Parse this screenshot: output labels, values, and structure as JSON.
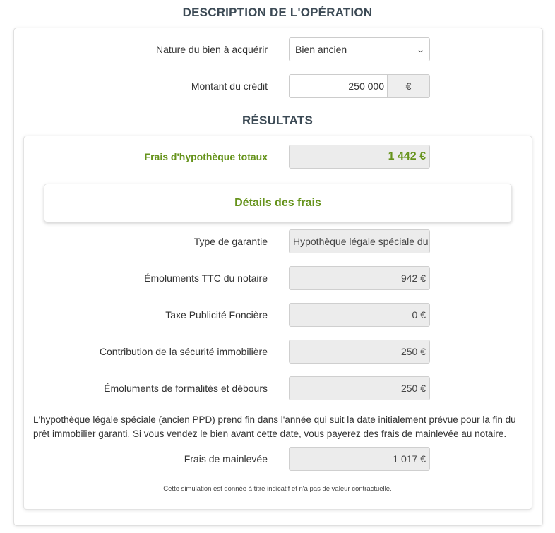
{
  "description_title": "DESCRIPTION DE L'OPÉRATION",
  "nature": {
    "label": "Nature du bien à acquérir",
    "value": "Bien ancien"
  },
  "montant": {
    "label": "Montant du crédit",
    "value": "250 000",
    "unit": "€"
  },
  "results_title": "RÉSULTATS",
  "total": {
    "label": "Frais d'hypothèque totaux",
    "value": "1 442 €"
  },
  "details_title": "Détails des frais",
  "details": {
    "garantie": {
      "label": "Type de garantie",
      "value": "Hypothèque légale spéciale du"
    },
    "emoluments": {
      "label": "Émoluments TTC du notaire",
      "value": "942 €"
    },
    "taxe": {
      "label": "Taxe Publicité Foncière",
      "value": "0 €"
    },
    "contribution": {
      "label": "Contribution de la sécurité immobilière",
      "value": "250 €"
    },
    "formalites": {
      "label": "Émoluments de formalités et débours",
      "value": "250 €"
    }
  },
  "note": "L'hypothèque légale spéciale (ancien PPD) prend fin dans l'année qui suit la date initialement prévue pour la fin du prêt immobilier garanti. Si vous vendez le bien avant cette date, vous payerez des frais de mainlevée au notaire.",
  "mainlevee": {
    "label": "Frais de mainlevée",
    "value": "1 017 €"
  },
  "disclaimer": "Cette simulation est donnée à titre indicatif et n'a pas de valeur contractuelle.",
  "colors": {
    "accent_green": "#66931c",
    "title": "#3c4a55"
  },
  "icons": {
    "select_chevron": "chevron-down-icon"
  }
}
